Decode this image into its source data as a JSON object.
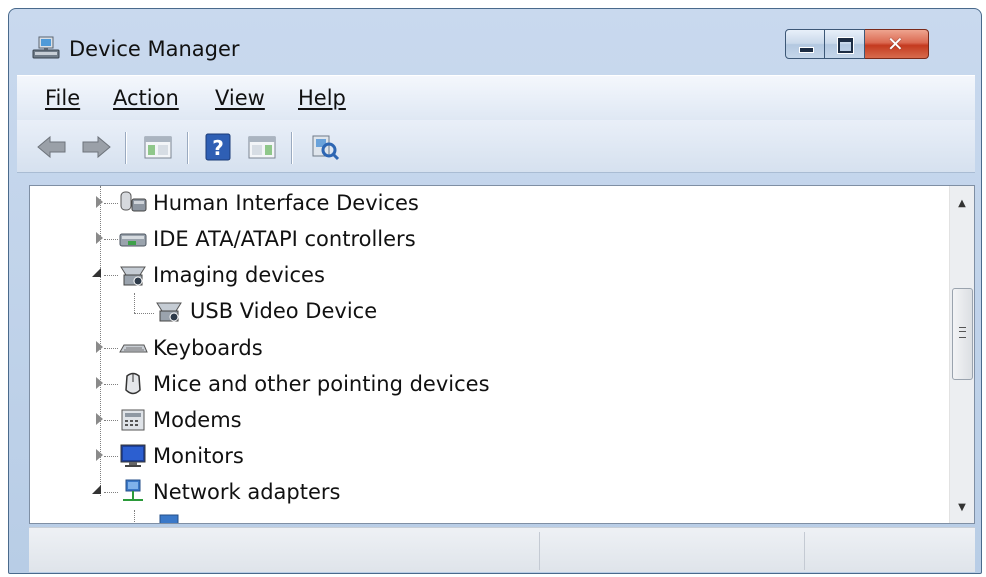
{
  "window": {
    "title": "Device Manager",
    "icon": "device-manager-icon"
  },
  "menu": {
    "file": "File",
    "action": "Action",
    "view": "View",
    "help": "Help"
  },
  "toolbar": {
    "buttons": [
      "back-arrow-icon",
      "forward-arrow-icon",
      "show-hide-console-tree-icon",
      "help-icon",
      "show-hide-action-pane-icon",
      "scan-hardware-changes-icon"
    ]
  },
  "tree": {
    "items": [
      {
        "label": "Human Interface Devices",
        "expanded": false,
        "icon": "hid-icon"
      },
      {
        "label": "IDE ATA/ATAPI controllers",
        "expanded": false,
        "icon": "ide-controller-icon"
      },
      {
        "label": "Imaging devices",
        "expanded": true,
        "icon": "imaging-device-icon"
      },
      {
        "label": "USB Video Device",
        "child": true,
        "icon": "webcam-icon"
      },
      {
        "label": "Keyboards",
        "expanded": false,
        "icon": "keyboard-icon"
      },
      {
        "label": "Mice and other pointing devices",
        "expanded": false,
        "icon": "mouse-icon"
      },
      {
        "label": "Modems",
        "expanded": false,
        "icon": "modem-icon"
      },
      {
        "label": "Monitors",
        "expanded": false,
        "icon": "monitor-icon"
      },
      {
        "label": "Network adapters",
        "expanded": true,
        "icon": "network-adapter-icon"
      }
    ]
  },
  "colors": {
    "titlebar": "#c9d9ee",
    "close_button": "#c43a1f",
    "tree_background": "#ffffff"
  }
}
